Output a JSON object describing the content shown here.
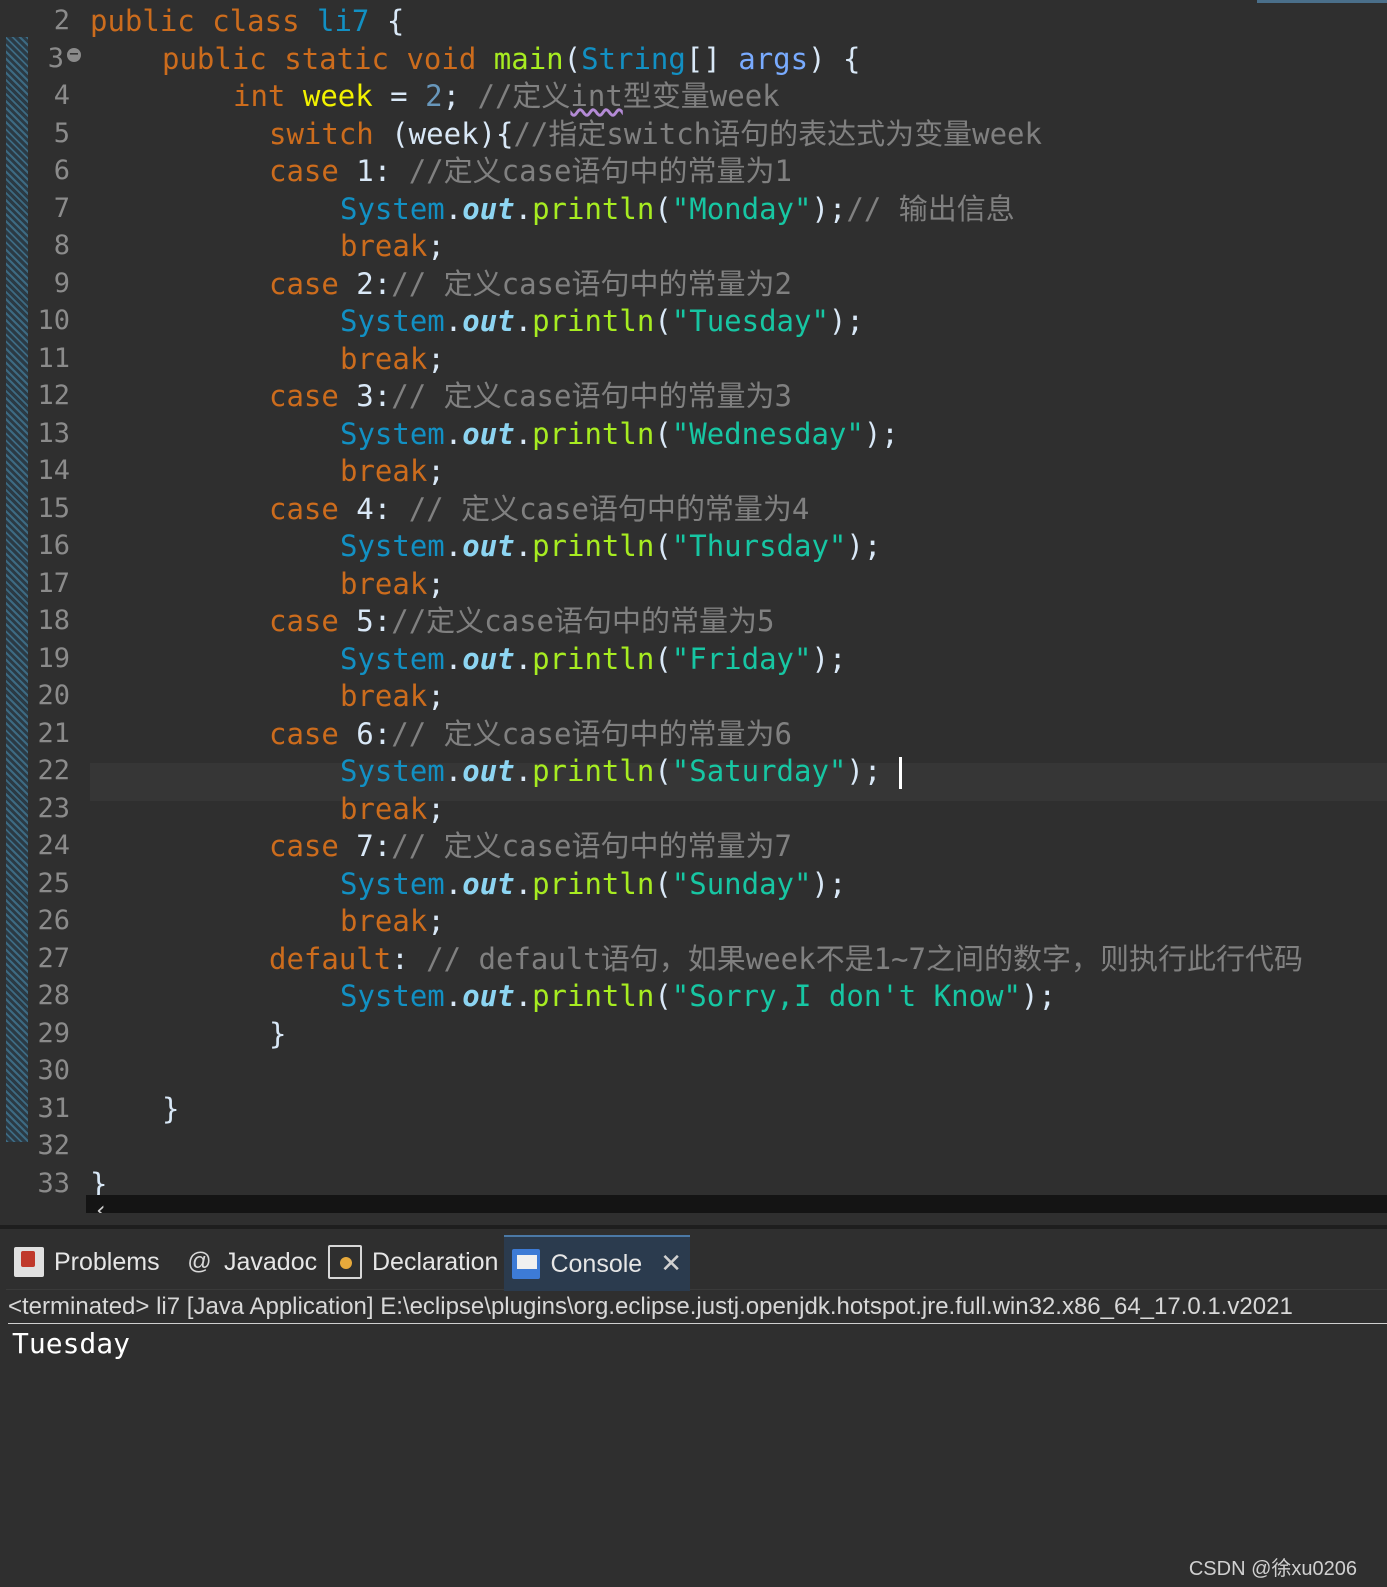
{
  "editor": {
    "line_numbers": [
      "2",
      "3",
      "4",
      "5",
      "6",
      "7",
      "8",
      "9",
      "10",
      "11",
      "12",
      "13",
      "14",
      "15",
      "16",
      "17",
      "18",
      "19",
      "20",
      "21",
      "22",
      "23",
      "24",
      "25",
      "26",
      "27",
      "28",
      "29",
      "30",
      "31",
      "32",
      "33"
    ],
    "fold_marker": "−",
    "code": {
      "l2": {
        "kw1": "public",
        "kw2": "class",
        "cls": "li7",
        "rest": " {"
      },
      "l3": {
        "kw1": "public",
        "kw2": "static",
        "kw3": "void",
        "meth": "main",
        "p1": "(",
        "cls": "String",
        "p2": "[] ",
        "param": "args",
        "p3": ") {"
      },
      "l4": {
        "kw": "int",
        "var": "week",
        "p1": " = ",
        "num": "2",
        "p2": "; ",
        "c1": "//定义",
        "c2": "int",
        "c3": "型变量week"
      },
      "l5": {
        "kw": "switch",
        "p": " (week){",
        "cmt": "//指定switch语句的表达式为变量week"
      },
      "l6": {
        "kw": "case",
        "p": " 1: ",
        "cmt": "//定义case语句中的常量为1"
      },
      "l7": {
        "cls": "System",
        "dot1": ".",
        "out": "out",
        "dot2": ".",
        "meth": "println",
        "p1": "(",
        "str": "\"Monday\"",
        "p2": ");",
        "cmt": "// 输出信息"
      },
      "l8": {
        "brk": "break",
        "p": ";"
      },
      "l9": {
        "kw": "case",
        "p": " 2:",
        "cmt": "// 定义case语句中的常量为2"
      },
      "l10": {
        "cls": "System",
        "dot1": ".",
        "out": "out",
        "dot2": ".",
        "meth": "println",
        "p1": "(",
        "str": "\"Tuesday\"",
        "p2": ");"
      },
      "l11": {
        "brk": "break",
        "p": ";"
      },
      "l12": {
        "kw": "case",
        "p": " 3:",
        "cmt": "// 定义case语句中的常量为3"
      },
      "l13": {
        "cls": "System",
        "dot1": ".",
        "out": "out",
        "dot2": ".",
        "meth": "println",
        "p1": "(",
        "str": "\"Wednesday\"",
        "p2": ");"
      },
      "l14": {
        "brk": "break",
        "p": ";"
      },
      "l15": {
        "kw": "case",
        "p": " 4: ",
        "cmt": "// 定义case语句中的常量为4"
      },
      "l16": {
        "cls": "System",
        "dot1": ".",
        "out": "out",
        "dot2": ".",
        "meth": "println",
        "p1": "(",
        "str": "\"Thursday\"",
        "p2": ");"
      },
      "l17": {
        "brk": "break",
        "p": ";"
      },
      "l18": {
        "kw": "case",
        "p": " 5:",
        "cmt": "//定义case语句中的常量为5"
      },
      "l19": {
        "cls": "System",
        "dot1": ".",
        "out": "out",
        "dot2": ".",
        "meth": "println",
        "p1": "(",
        "str": "\"Friday\"",
        "p2": ");"
      },
      "l20": {
        "brk": "break",
        "p": ";"
      },
      "l21": {
        "kw": "case",
        "p": " 6:",
        "cmt": "// 定义case语句中的常量为6"
      },
      "l22": {
        "cls": "System",
        "dot1": ".",
        "out": "out",
        "dot2": ".",
        "meth": "println",
        "p1": "(",
        "str": "\"Saturday\"",
        "p2": ");"
      },
      "l23": {
        "brk": "break",
        "p": ";"
      },
      "l24": {
        "kw": "case",
        "p": " 7:",
        "cmt": "// 定义case语句中的常量为7"
      },
      "l25": {
        "cls": "System",
        "dot1": ".",
        "out": "out",
        "dot2": ".",
        "meth": "println",
        "p1": "(",
        "str": "\"Sunday\"",
        "p2": ");"
      },
      "l26": {
        "brk": "break",
        "p": ";"
      },
      "l27": {
        "kw": "default",
        "p": ": ",
        "cmt": "// default语句，如果week不是1~7之间的数字，则执行此行代码"
      },
      "l28": {
        "cls": "System",
        "dot1": ".",
        "out": "out",
        "dot2": ".",
        "meth": "println",
        "p1": "(",
        "str": "\"Sorry,I don't Know\"",
        "p2": ");"
      },
      "l29": {
        "p": "}"
      },
      "l31": {
        "p": "}"
      },
      "l33": {
        "p": "}"
      }
    },
    "scroll_left": "‹"
  },
  "views": {
    "tabs": [
      {
        "label": "Problems",
        "icon": "problems-icon"
      },
      {
        "label": "Javadoc",
        "icon": "javadoc-icon",
        "icon_glyph": "@"
      },
      {
        "label": "Declaration",
        "icon": "declaration-icon"
      },
      {
        "label": "Console",
        "icon": "console-icon",
        "active": true,
        "close": "✕"
      }
    ],
    "status": "<terminated> li7 [Java Application] E:\\eclipse\\plugins\\org.eclipse.justj.openjdk.hotspot.jre.full.win32.x86_64_17.0.1.v2021",
    "output": "Tuesday"
  },
  "watermark": "CSDN @徐xu0206",
  "colors": {
    "keyword": "#cc6c1d",
    "class": "#1290c3",
    "string": "#17c6a3",
    "comment": "#808080",
    "method": "#a7ec21",
    "variable": "#f2f200"
  }
}
